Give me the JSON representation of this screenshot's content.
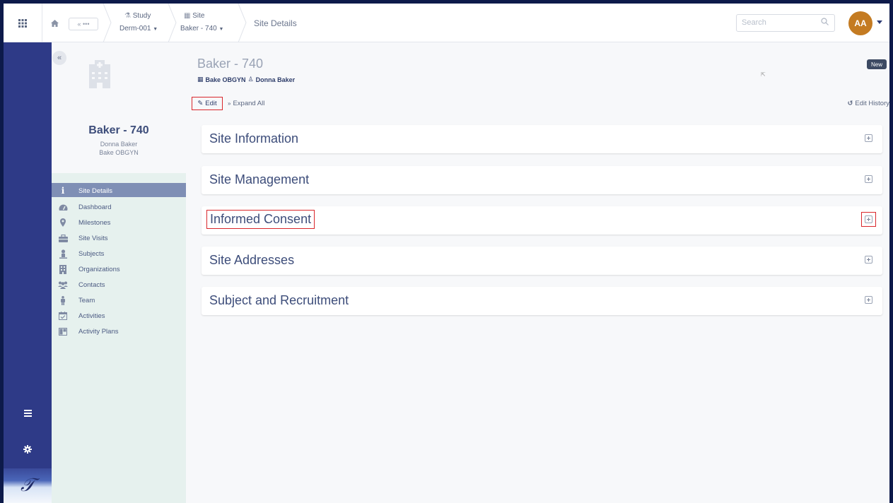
{
  "topbar": {
    "back_label": "« •••",
    "study": {
      "label": "Study",
      "value": "Derm-001"
    },
    "site": {
      "label": "Site",
      "value": "Baker - 740"
    },
    "current": "Site Details",
    "search_placeholder": "Search",
    "avatar_initials": "AA"
  },
  "side": {
    "collapse_label": "«",
    "site_name": "Baker - 740",
    "contact": "Donna Baker",
    "org": "Bake OBGYN",
    "nav": [
      {
        "label": "Site Details",
        "icon": "info-icon",
        "active": true
      },
      {
        "label": "Dashboard",
        "icon": "dashboard-icon"
      },
      {
        "label": "Milestones",
        "icon": "map-pin-icon"
      },
      {
        "label": "Site Visits",
        "icon": "briefcase-icon"
      },
      {
        "label": "Subjects",
        "icon": "subject-icon"
      },
      {
        "label": "Organizations",
        "icon": "building-icon"
      },
      {
        "label": "Contacts",
        "icon": "users-icon"
      },
      {
        "label": "Team",
        "icon": "person-icon"
      },
      {
        "label": "Activities",
        "icon": "calendar-check-icon"
      },
      {
        "label": "Activity Plans",
        "icon": "plan-board-icon"
      }
    ]
  },
  "main": {
    "title": "Baker - 740",
    "org": "Bake OBGYN",
    "contact": "Donna Baker",
    "badge": "New",
    "edit_label": "Edit",
    "expand_all_label": "Expand All",
    "edit_history_label": "Edit History",
    "sections": [
      {
        "title": "Site Information"
      },
      {
        "title": "Site Management"
      },
      {
        "title": "Informed Consent"
      },
      {
        "title": "Site Addresses"
      },
      {
        "title": "Subject and Recruitment"
      }
    ]
  },
  "colors": {
    "rail": "#2e3a87",
    "side_panel": "#e6f1ee",
    "active_nav": "#7f8fb5",
    "avatar": "#c47b22",
    "highlight": "#d9262b"
  }
}
